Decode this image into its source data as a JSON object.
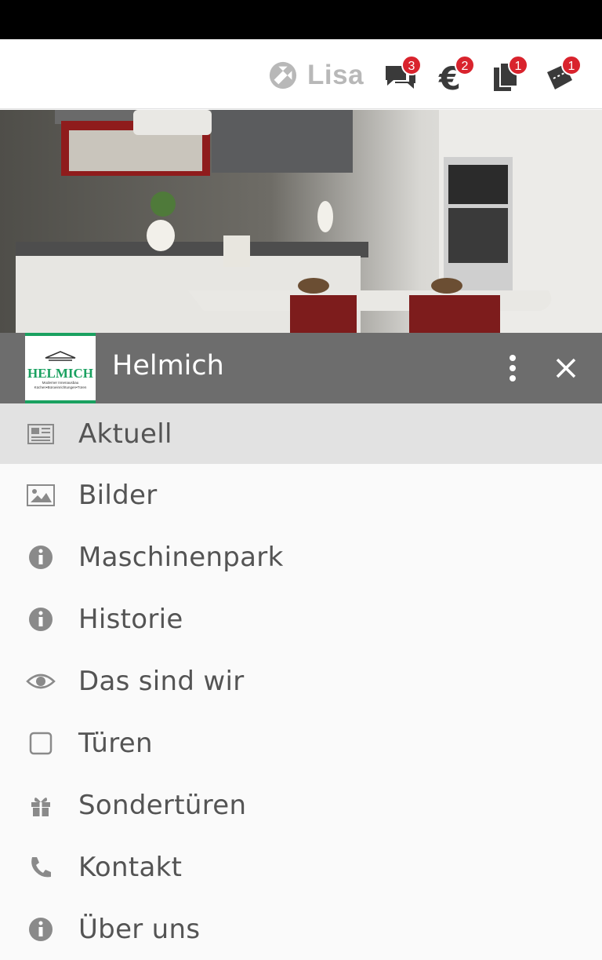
{
  "topbar": {
    "brand_name": "Lisa",
    "brand_icon": "lisa-logo-icon",
    "actions": [
      {
        "icon": "chat-icon",
        "badge": "3"
      },
      {
        "icon": "euro-icon",
        "badge": "2"
      },
      {
        "icon": "documents-icon",
        "badge": "1"
      },
      {
        "icon": "coupon-icon",
        "badge": "1"
      }
    ]
  },
  "hero": {
    "image": "kitchen-photo"
  },
  "drawer": {
    "logo": {
      "text": "HELMICH",
      "subtitle1": "Moderner Innenausbau",
      "subtitle2": "Küchen•Büroeinrichtungen•Türen"
    },
    "title": "Helmich",
    "items": [
      {
        "label": "Aktuell",
        "icon": "newspaper-icon",
        "active": true
      },
      {
        "label": "Bilder",
        "icon": "image-icon"
      },
      {
        "label": "Maschinenpark",
        "icon": "info-icon"
      },
      {
        "label": "Historie",
        "icon": "info-icon"
      },
      {
        "label": "Das sind wir",
        "icon": "eye-icon"
      },
      {
        "label": "Türen",
        "icon": "square-icon"
      },
      {
        "label": "Sondertüren",
        "icon": "gift-icon"
      },
      {
        "label": "Kontakt",
        "icon": "phone-icon"
      },
      {
        "label": "Über uns",
        "icon": "info-icon"
      }
    ]
  },
  "colors": {
    "badge": "#d9232d",
    "drawer_header": "#6d6d6d",
    "logo_accent": "#1aa160",
    "active_item": "#e2e2e2",
    "text": "#545454"
  }
}
